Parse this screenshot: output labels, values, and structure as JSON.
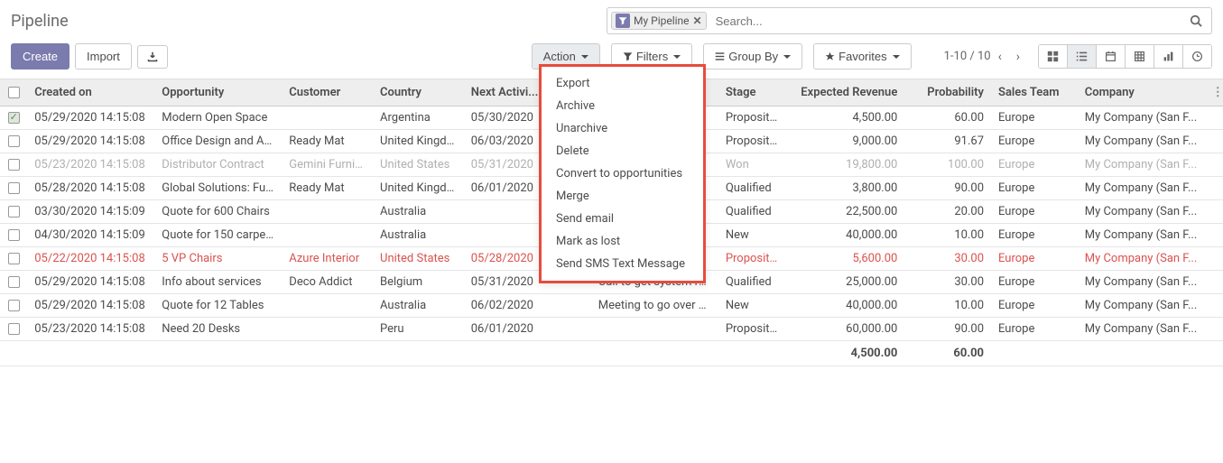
{
  "page": {
    "title": "Pipeline"
  },
  "search": {
    "chip_label": "My Pipeline",
    "placeholder": "Search..."
  },
  "toolbar": {
    "create": "Create",
    "import": "Import",
    "action": "Action",
    "filters": "Filters",
    "group_by": "Group By",
    "favorites": "Favorites",
    "pager": "1-10 / 10"
  },
  "action_menu": [
    "Export",
    "Archive",
    "Unarchive",
    "Delete",
    "Convert to opportunities",
    "Merge",
    "Send email",
    "Mark as lost",
    "Send SMS Text Message"
  ],
  "columns": {
    "created_on": "Created on",
    "opportunity": "Opportunity",
    "customer": "Customer",
    "country": "Country",
    "next_activity": "Next Activi...",
    "activity_summary": "",
    "stage": "Stage",
    "expected_revenue": "Expected Revenue",
    "probability": "Probability",
    "sales_team": "Sales Team",
    "company": "Company"
  },
  "rows": [
    {
      "checked": true,
      "style": "",
      "created_on": "05/29/2020 14:15:08",
      "opportunity": "Modern Open Space",
      "customer": "",
      "country": "Argentina",
      "next_activity": "05/30/2020",
      "activity_summary": "",
      "stage": "Proposition",
      "expected_revenue": "4,500.00",
      "probability": "60.00",
      "sales_team": "Europe",
      "company": "My Company (San F..."
    },
    {
      "checked": false,
      "style": "",
      "created_on": "05/29/2020 14:15:08",
      "opportunity": "Office Design and Ar...",
      "customer": "Ready Mat",
      "country": "United Kingdom",
      "next_activity": "06/03/2020",
      "activity_summary": "",
      "stage": "Proposition",
      "expected_revenue": "9,000.00",
      "probability": "91.67",
      "sales_team": "Europe",
      "company": "My Company (San F..."
    },
    {
      "checked": false,
      "style": "grey",
      "created_on": "05/23/2020 14:15:08",
      "opportunity": "Distributor Contract",
      "customer": "Gemini Furniture",
      "country": "United States",
      "next_activity": "05/31/2020",
      "activity_summary": "",
      "stage": "Won",
      "expected_revenue": "19,800.00",
      "probability": "100.00",
      "sales_team": "Europe",
      "company": "My Company (San F..."
    },
    {
      "checked": false,
      "style": "",
      "created_on": "05/28/2020 14:15:08",
      "opportunity": "Global Solutions: Fu...",
      "customer": "Ready Mat",
      "country": "United Kingdom",
      "next_activity": "06/01/2020",
      "activity_summary": "",
      "stage": "Qualified",
      "expected_revenue": "3,800.00",
      "probability": "90.00",
      "sales_team": "Europe",
      "company": "My Company (San F..."
    },
    {
      "checked": false,
      "style": "",
      "created_on": "03/30/2020 14:15:09",
      "opportunity": "Quote for 600 Chairs",
      "customer": "",
      "country": "Australia",
      "next_activity": "",
      "activity_summary": "",
      "stage": "Qualified",
      "expected_revenue": "22,500.00",
      "probability": "20.00",
      "sales_team": "Europe",
      "company": "My Company (San F..."
    },
    {
      "checked": false,
      "style": "",
      "created_on": "04/30/2020 14:15:09",
      "opportunity": "Quote for 150 carpets",
      "customer": "",
      "country": "Australia",
      "next_activity": "",
      "activity_summary": "",
      "stage": "New",
      "expected_revenue": "40,000.00",
      "probability": "10.00",
      "sales_team": "Europe",
      "company": "My Company (San F..."
    },
    {
      "checked": false,
      "style": "red",
      "created_on": "05/22/2020 14:15:08",
      "opportunity": "5 VP Chairs",
      "customer": "Azure Interior",
      "country": "United States",
      "next_activity": "05/28/2020",
      "activity_summary": "",
      "stage": "Proposition",
      "expected_revenue": "5,600.00",
      "probability": "30.00",
      "sales_team": "Europe",
      "company": "My Company (San F..."
    },
    {
      "checked": false,
      "style": "",
      "created_on": "05/29/2020 14:15:08",
      "opportunity": "Info about services",
      "customer": "Deco Addict",
      "country": "Belgium",
      "next_activity": "05/31/2020",
      "activity_summary": "Call to get system re...",
      "stage": "Qualified",
      "expected_revenue": "25,000.00",
      "probability": "30.00",
      "sales_team": "Europe",
      "company": "My Company (San F..."
    },
    {
      "checked": false,
      "style": "",
      "created_on": "05/29/2020 14:15:08",
      "opportunity": "Quote for 12 Tables",
      "customer": "",
      "country": "Australia",
      "next_activity": "06/02/2020",
      "activity_summary": "Meeting to go over p...",
      "stage": "New",
      "expected_revenue": "40,000.00",
      "probability": "10.00",
      "sales_team": "Europe",
      "company": "My Company (San F..."
    },
    {
      "checked": false,
      "style": "",
      "created_on": "05/23/2020 14:15:08",
      "opportunity": "Need 20 Desks",
      "customer": "",
      "country": "Peru",
      "next_activity": "06/01/2020",
      "activity_summary": "",
      "stage": "Proposition",
      "expected_revenue": "60,000.00",
      "probability": "90.00",
      "sales_team": "Europe",
      "company": "My Company (San F..."
    }
  ],
  "footer": {
    "expected_revenue": "4,500.00",
    "probability": "60.00"
  }
}
